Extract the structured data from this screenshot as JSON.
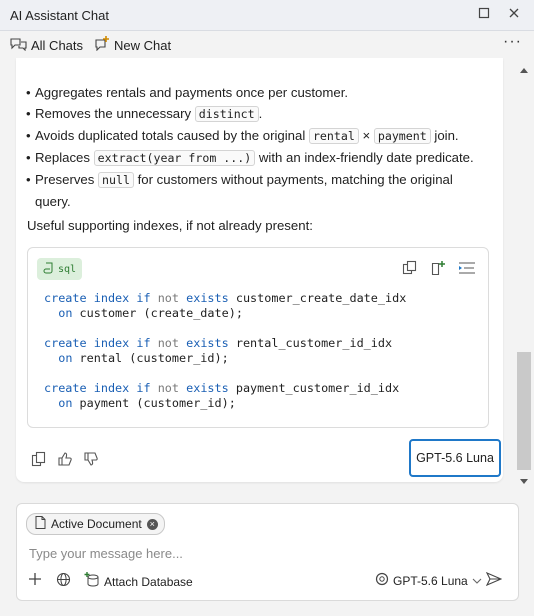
{
  "window": {
    "title": "AI Assistant Chat"
  },
  "toolbar": {
    "all_chats": "All Chats",
    "new_chat": "New Chat",
    "more": "···"
  },
  "message": {
    "bullet_parts": [
      {
        "t1": "Aggregates rentals and payments once per customer."
      },
      {
        "t1": "Removes the unnecessary ",
        "c1": "distinct",
        "t2": "."
      },
      {
        "t1": "Avoids duplicated totals caused by the original ",
        "c1": "rental",
        "t2": " × ",
        "c2": "payment",
        "t3": " join."
      },
      {
        "t1": "Replaces ",
        "c1": "extract(year from ...)",
        "t2": " with an index-friendly date predicate."
      },
      {
        "t1": "Preserves ",
        "c1": "null",
        "t2": " for customers without payments, matching the original query."
      }
    ],
    "paragraph": "Useful supporting indexes, if not already present:",
    "code": {
      "language": "sql",
      "statements": [
        {
          "kw1": "create",
          "kw2": "index",
          "kw3": "if",
          "kw4": "not",
          "kw5": "exists",
          "name": "customer_create_date_idx",
          "on": "on",
          "table": "customer",
          "cols": "(create_date);"
        },
        {
          "kw1": "create",
          "kw2": "index",
          "kw3": "if",
          "kw4": "not",
          "kw5": "exists",
          "name": "rental_customer_id_idx",
          "on": "on",
          "table": "rental",
          "cols": "(customer_id);"
        },
        {
          "kw1": "create",
          "kw2": "index",
          "kw3": "if",
          "kw4": "not",
          "kw5": "exists",
          "name": "payment_customer_id_idx",
          "on": "on",
          "table": "payment",
          "cols": "(customer_id);"
        }
      ]
    },
    "model_label": "GPT-5.6 Luna"
  },
  "composer": {
    "chip_label": "Active Document",
    "placeholder": "Type your message here...",
    "attach_database": "Attach Database",
    "model": "GPT-5.6 Luna"
  },
  "colors": {
    "accent": "#1f78c8",
    "keyword": "#1a5fb4",
    "lang_badge_bg": "#dcefdc",
    "lang_badge_fg": "#2e7d32"
  }
}
